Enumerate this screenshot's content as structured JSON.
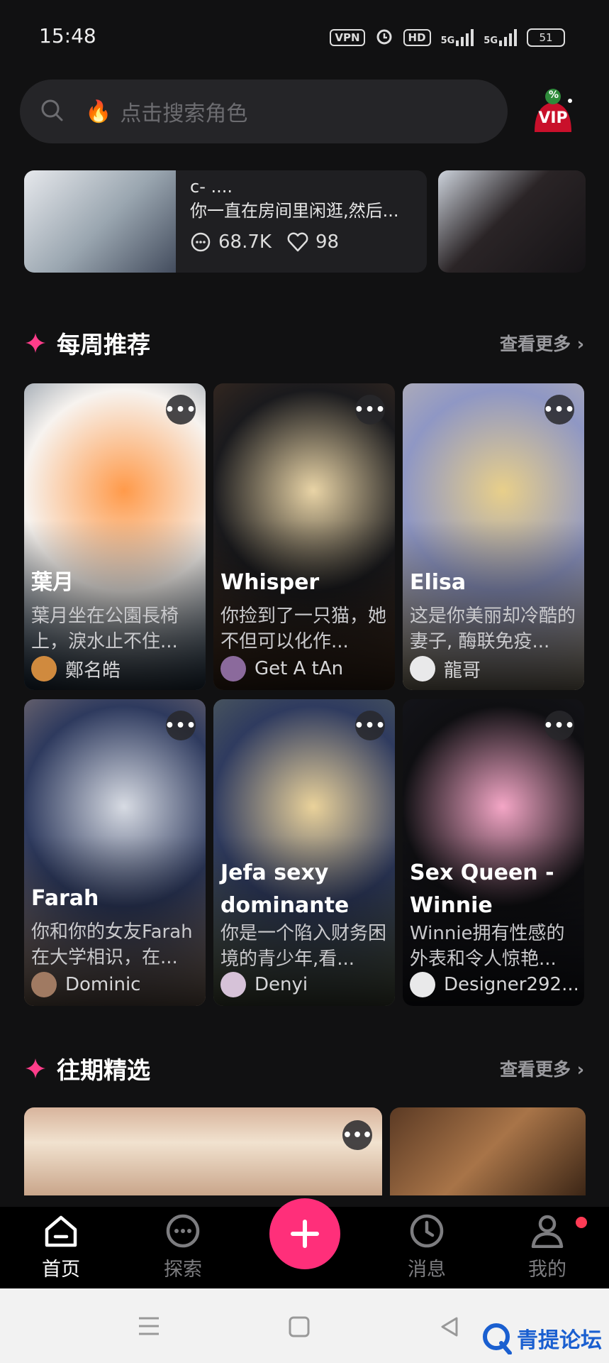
{
  "status": {
    "time": "15:48",
    "vpn": "VPN",
    "hd": "HD",
    "net1": "5G",
    "net2": "5G",
    "battery": "51"
  },
  "search": {
    "placeholder": "点击搜索角色",
    "fire_icon": "fire-icon"
  },
  "vip": {
    "label": "VIP",
    "badge": "%"
  },
  "featured": {
    "line1": "c- ....",
    "line2": "你一直在房间里闲逛,然后...",
    "chats": "68.7K",
    "likes": "98"
  },
  "weekly": {
    "title": "每周推荐",
    "more": "查看更多",
    "cards": [
      {
        "name": "葉月",
        "desc": "葉月坐在公園長椅上，淚水止不住...",
        "author": "鄭名皓",
        "colors": [
          "#27425e",
          "#ff9a4a",
          "#f7f3ef"
        ],
        "avatar": "#d08a3e"
      },
      {
        "name": "Whisper",
        "desc": "你捡到了一只猫，她不但可以化作...",
        "author": "Get A tAn",
        "colors": [
          "#5a3b25",
          "#e9d4a6",
          "#1a1a1d"
        ],
        "avatar": "#8b6a9c"
      },
      {
        "name": "Elisa",
        "desc": "这是你美丽却冷酷的妻子, 酶联免疫...",
        "author": "龍哥",
        "colors": [
          "#d9caa8",
          "#e8cf8a",
          "#8f97c4"
        ],
        "avatar": "#e9e9ea"
      },
      {
        "name": "Farah",
        "desc": "你和你的女友Farah在大学相识，在...",
        "author": "Dominic",
        "colors": [
          "#b99a82",
          "#d7dbe3",
          "#2e3a5e"
        ],
        "avatar": "#a07a62"
      },
      {
        "name": "Jefa sexy dominante",
        "desc": "你是一个陷入财务困境的青少年,看...",
        "author": "Denyi",
        "colors": [
          "#6e7a5a",
          "#ead29a",
          "#2f3b5f"
        ],
        "avatar": "#d6c2d8"
      },
      {
        "name": "Sex Queen - Winnie",
        "desc": "Winnie拥有性感的外表和令人惊艳...",
        "author": "Designer292...",
        "colors": [
          "#1b1c25",
          "#f4a6c6",
          "#0f0f12"
        ],
        "avatar": "#e9e9ea"
      }
    ]
  },
  "past": {
    "title": "往期精选",
    "more": "查看更多"
  },
  "tabs": [
    {
      "label": "首页",
      "icon": "home-icon",
      "active": true
    },
    {
      "label": "探索",
      "icon": "chat-bubble-icon",
      "active": false
    },
    {
      "label": "消息",
      "icon": "clock-icon",
      "active": false
    },
    {
      "label": "我的",
      "icon": "profile-icon",
      "active": false
    }
  ],
  "fab_icon": "plus-icon",
  "accent": "#ff2f7a",
  "watermark": "青提论坛"
}
